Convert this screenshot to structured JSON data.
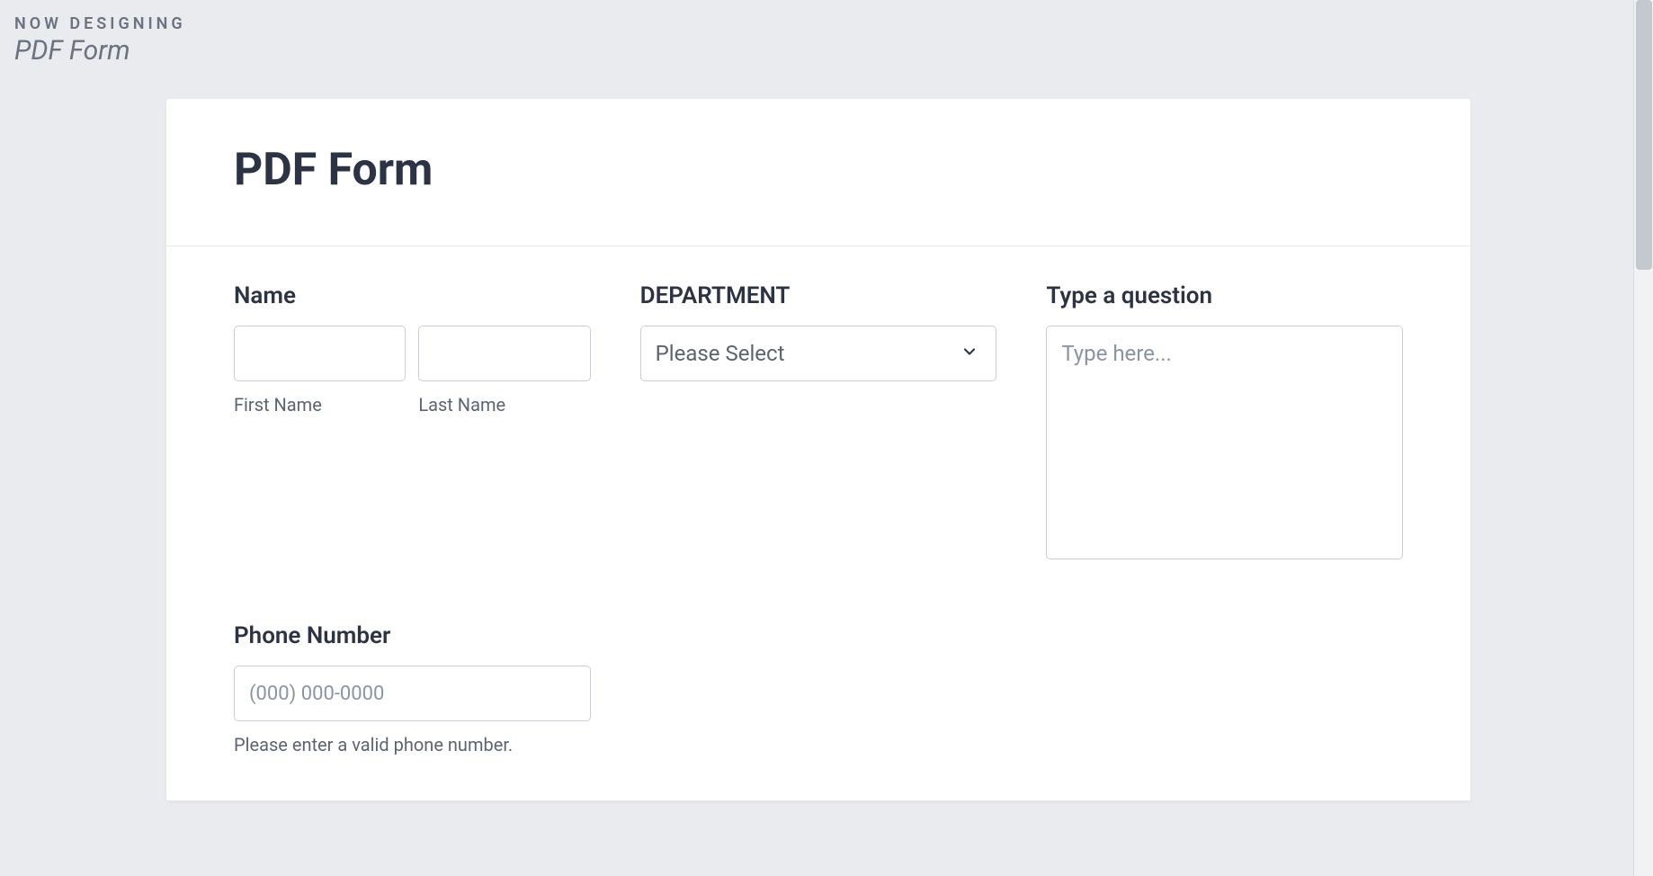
{
  "topbar": {
    "eyebrow": "NOW DESIGNING",
    "title": "PDF Form"
  },
  "form": {
    "title": "PDF Form",
    "fields": {
      "name": {
        "label": "Name",
        "first_sublabel": "First Name",
        "last_sublabel": "Last Name",
        "first_value": "",
        "last_value": ""
      },
      "department": {
        "label": "DEPARTMENT",
        "selected": "Please Select"
      },
      "question": {
        "label": "Type a question",
        "placeholder": "Type here...",
        "value": ""
      },
      "phone": {
        "label": "Phone Number",
        "placeholder": "(000) 000-0000",
        "value": "",
        "helptext": "Please enter a valid phone number."
      }
    }
  }
}
